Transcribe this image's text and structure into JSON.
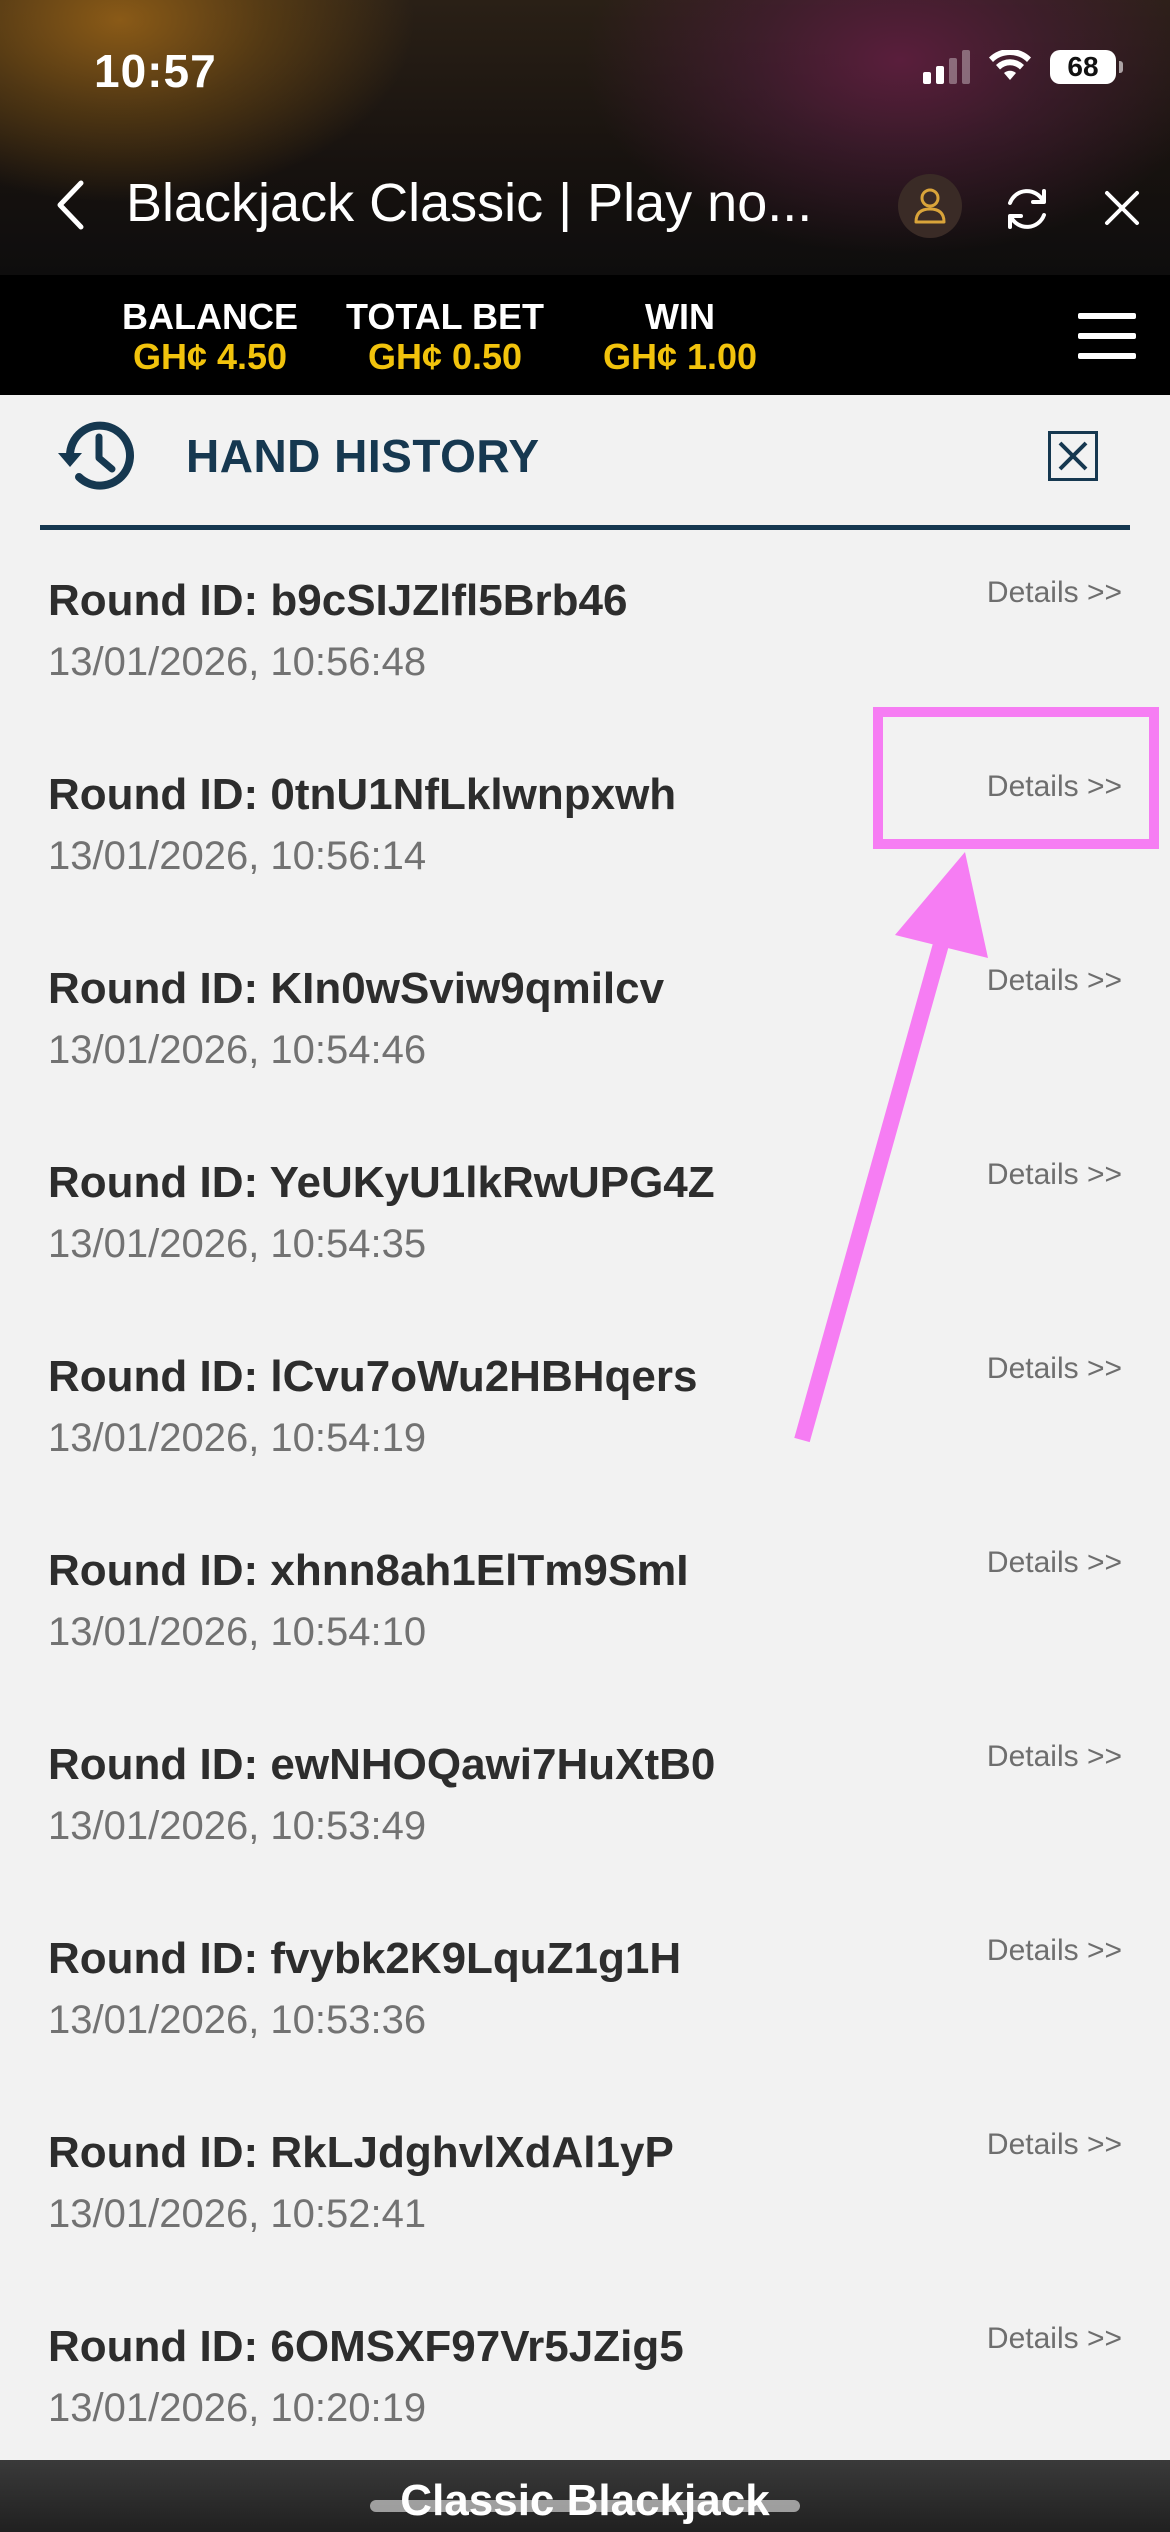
{
  "status_bar": {
    "time": "10:57",
    "battery": "68"
  },
  "header": {
    "title": "Blackjack Classic | Play no..."
  },
  "game_bar": {
    "balance_label": "BALANCE",
    "balance_value": "GH¢ 4.50",
    "total_bet_label": "TOTAL BET",
    "total_bet_value": "GH¢ 0.50",
    "win_label": "WIN",
    "win_value": "GH¢ 1.00"
  },
  "hand_history": {
    "title": "HAND HISTORY",
    "details_label": "Details >>",
    "rounds": [
      {
        "id": "Round ID: b9cSIJZlfl5Brb46",
        "time": "13/01/2026, 10:56:48",
        "details": "Details >>"
      },
      {
        "id": "Round ID: 0tnU1NfLklwnpxwh",
        "time": "13/01/2026, 10:56:14",
        "details": "Details >>"
      },
      {
        "id": "Round ID: KIn0wSviw9qmilcv",
        "time": "13/01/2026, 10:54:46",
        "details": "Details >>"
      },
      {
        "id": "Round ID: YeUKyU1lkRwUPG4Z",
        "time": "13/01/2026, 10:54:35",
        "details": "Details >>"
      },
      {
        "id": "Round ID: lCvu7oWu2HBHqers",
        "time": "13/01/2026, 10:54:19",
        "details": "Details >>"
      },
      {
        "id": "Round ID: xhnn8ah1ElTm9SmI",
        "time": "13/01/2026, 10:54:10",
        "details": "Details >>"
      },
      {
        "id": "Round ID: ewNHOQawi7HuXtB0",
        "time": "13/01/2026, 10:53:49",
        "details": "Details >>"
      },
      {
        "id": "Round ID: fvybk2K9LquZ1g1H",
        "time": "13/01/2026, 10:53:36",
        "details": "Details >>"
      },
      {
        "id": "Round ID: RkLJdghvlXdAl1yP",
        "time": "13/01/2026, 10:52:41",
        "details": "Details >>"
      },
      {
        "id": "Round ID: 6OMSXF97Vr5JZig5",
        "time": "13/01/2026, 10:20:19",
        "details": "Details >>"
      }
    ]
  },
  "annotation": {
    "color": "#f67df3"
  },
  "footer": {
    "title": "Classic Blackjack"
  },
  "colors": {
    "accent_navy": "#163850",
    "value_yellow": "#f2c30c",
    "profile_gold": "#d9a43a"
  }
}
